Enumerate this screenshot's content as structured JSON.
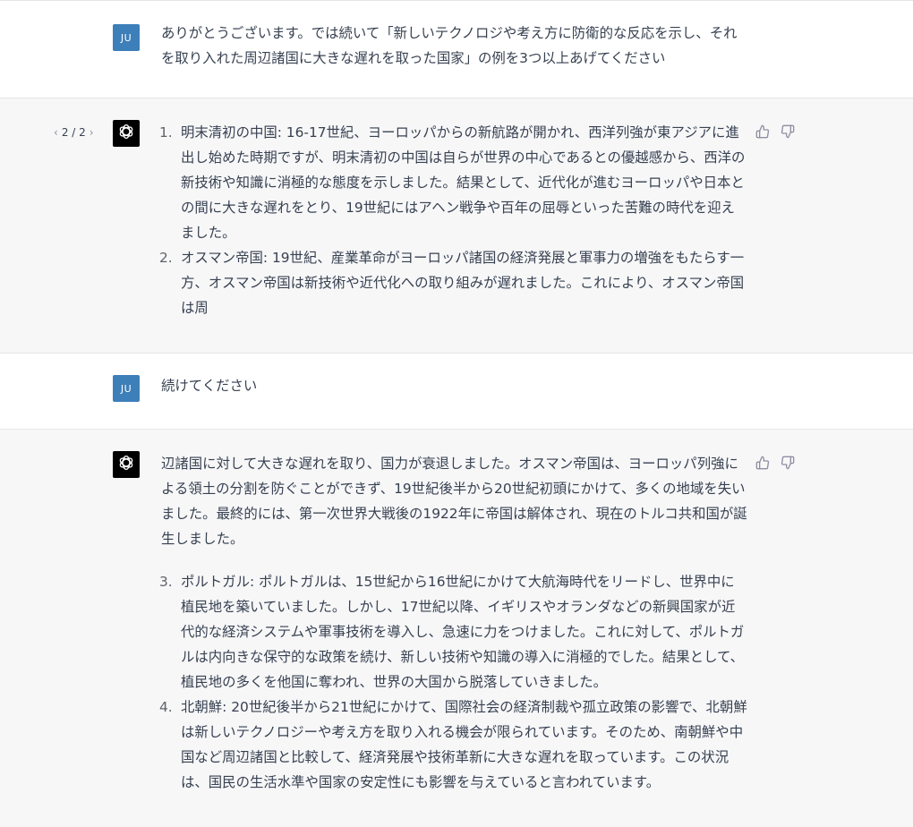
{
  "messages": [
    {
      "role": "user",
      "avatar_initials": "JU",
      "text": "ありがとうございます。では続いて「新しいテクノロジや考え方に防衛的な反応を示し、それを取り入れた周辺諸国に大きな遅れを取った国家」の例を3つ以上あげてください"
    },
    {
      "role": "assistant",
      "pager": {
        "prev": "‹",
        "label": "2 / 2",
        "next": "›"
      },
      "items": [
        {
          "num": "1.",
          "text": "明末清初の中国: 16-17世紀、ヨーロッパからの新航路が開かれ、西洋列強が東アジアに進出し始めた時期ですが、明末清初の中国は自らが世界の中心であるとの優越感から、西洋の新技術や知識に消極的な態度を示しました。結果として、近代化が進むヨーロッパや日本との間に大きな遅れをとり、19世紀にはアヘン戦争や百年の屈辱といった苦難の時代を迎えました。"
        },
        {
          "num": "2.",
          "text": "オスマン帝国: 19世紀、産業革命がヨーロッパ諸国の経済発展と軍事力の増強をもたらす一方、オスマン帝国は新技術や近代化への取り組みが遅れました。これにより、オスマン帝国は周"
        }
      ]
    },
    {
      "role": "user",
      "avatar_initials": "JU",
      "text": "続けてください"
    },
    {
      "role": "assistant",
      "intro": "辺諸国に対して大きな遅れを取り、国力が衰退しました。オスマン帝国は、ヨーロッパ列強による領土の分割を防ぐことができず、19世紀後半から20世紀初頭にかけて、多くの地域を失いました。最終的には、第一次世界大戦後の1922年に帝国は解体され、現在のトルコ共和国が誕生しました。",
      "items": [
        {
          "num": "3.",
          "text": "ポルトガル: ポルトガルは、15世紀から16世紀にかけて大航海時代をリードし、世界中に植民地を築いていました。しかし、17世紀以降、イギリスやオランダなどの新興国家が近代的な経済システムや軍事技術を導入し、急速に力をつけました。これに対して、ポルトガルは内向きな保守的な政策を続け、新しい技術や知識の導入に消極的でした。結果として、植民地の多くを他国に奪われ、世界の大国から脱落していきました。"
        },
        {
          "num": "4.",
          "text": "北朝鮮: 20世紀後半から21世紀にかけて、国際社会の経済制裁や孤立政策の影響で、北朝鮮は新しいテクノロジーや考え方を取り入れる機会が限られています。そのため、南朝鮮や中国など周辺諸国と比較して、経済発展や技術革新に大きな遅れを取っています。この状況は、国民の生活水準や国家の安定性にも影響を与えていると言われています。"
        }
      ]
    }
  ],
  "icons": {
    "assistant_avatar": "openai-logo-icon",
    "like": "thumbs-up-icon",
    "dislike": "thumbs-down-icon",
    "accent_user_avatar": "#3d7fb9",
    "assistant_bg": "#f7f7f8"
  }
}
